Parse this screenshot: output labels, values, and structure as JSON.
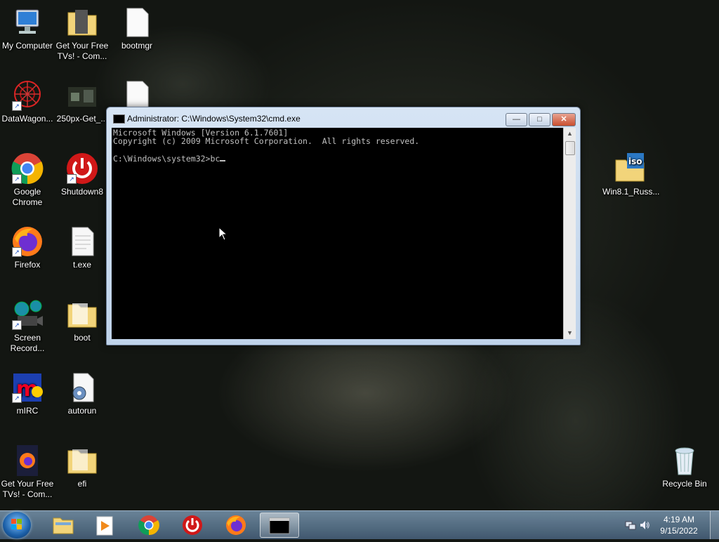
{
  "desktop_icons": [
    {
      "label": "My Computer"
    },
    {
      "label": "Get Your Free TVs! - Com..."
    },
    {
      "label": "bootmgr"
    },
    {
      "label": "DataWagon..."
    },
    {
      "label": "250px-Get_..."
    },
    {
      "label": "Google Chrome"
    },
    {
      "label": "Shutdown8"
    },
    {
      "label": "Firefox"
    },
    {
      "label": "t.exe"
    },
    {
      "label": "Screen Record..."
    },
    {
      "label": "boot"
    },
    {
      "label": "mIRC"
    },
    {
      "label": "autorun"
    },
    {
      "label": "Get Your Free TVs! - Com..."
    },
    {
      "label": "efi"
    },
    {
      "label": "Win8.1_Russ..."
    },
    {
      "label": "Recycle Bin"
    }
  ],
  "cmd": {
    "title": "Administrator: C:\\Windows\\System32\\cmd.exe",
    "line1": "Microsoft Windows [Version 6.1.7601]",
    "line2": "Copyright (c) 2009 Microsoft Corporation.  All rights reserved.",
    "prompt": "C:\\Windows\\system32>bc",
    "minimize": "—",
    "maximize": "□",
    "close": "✕"
  },
  "taskbar": {
    "items": [
      "explorer-icon",
      "media-player-icon",
      "chrome-icon",
      "shutdown-icon",
      "firefox-icon",
      "cmd-icon"
    ],
    "cmd_icon_text": "C:\\_"
  },
  "clock": {
    "time": "4:19 AM",
    "date": "9/15/2022"
  }
}
